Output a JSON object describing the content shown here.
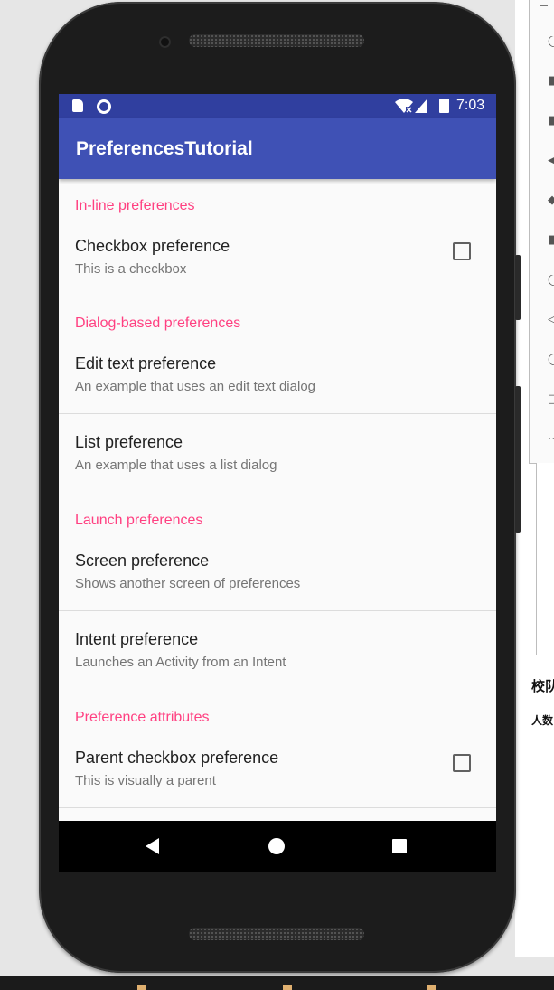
{
  "app": {
    "title": "PreferencesTutorial"
  },
  "status_bar": {
    "time": "7:03",
    "icons": [
      "sd-card-icon",
      "circle-notification-icon",
      "wifi-icon",
      "signal-icon",
      "battery-icon"
    ]
  },
  "categories": [
    {
      "label": "In-line preferences"
    },
    {
      "label": "Dialog-based preferences"
    },
    {
      "label": "Launch preferences"
    },
    {
      "label": "Preference attributes"
    }
  ],
  "preferences": [
    {
      "title": "Checkbox preference",
      "summary": "This is a checkbox",
      "checked": false
    },
    {
      "title": "Edit text preference",
      "summary": "An example that uses an edit text dialog"
    },
    {
      "title": "List preference",
      "summary": "An example that uses a list dialog"
    },
    {
      "title": "Screen preference",
      "summary": "Shows another screen of preferences"
    },
    {
      "title": "Intent preference",
      "summary": "Launches an Activity from an Intent"
    },
    {
      "title": "Parent checkbox preference",
      "summary": "This is visually a parent",
      "checked": false
    }
  ],
  "nav_bar": {
    "icons": [
      "back-icon",
      "home-icon",
      "recents-icon"
    ]
  },
  "side_panel": {
    "text_1": "校队",
    "text_2": "人数"
  },
  "colors": {
    "status_bar": "#303f9f",
    "app_bar": "#3f51b5",
    "accent": "#ff4081",
    "background": "#fafafa"
  }
}
